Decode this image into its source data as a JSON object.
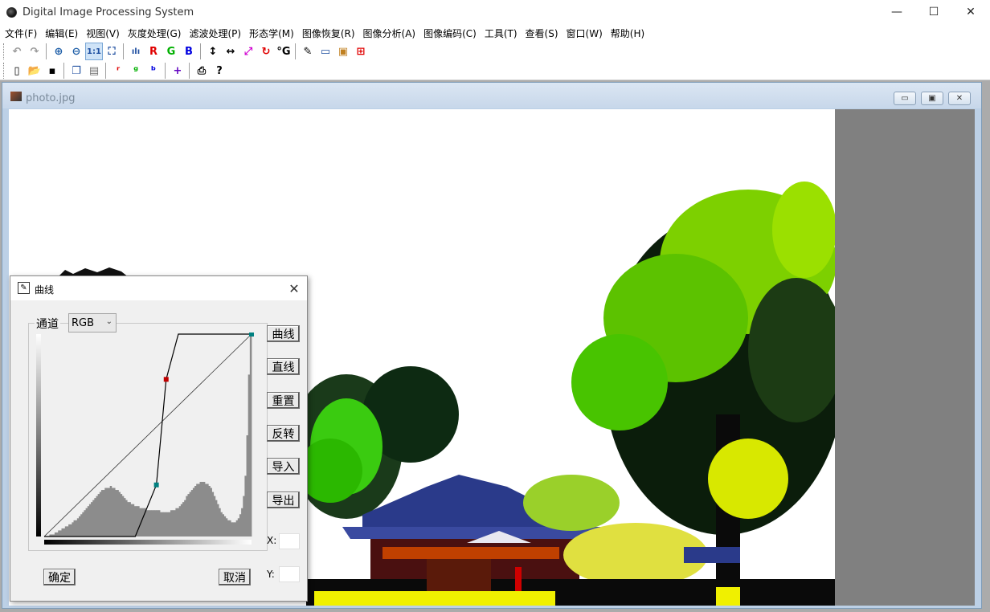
{
  "app": {
    "title": "Digital Image Processing System",
    "minimize": "—",
    "maximize": "☐",
    "close": "✕"
  },
  "menu": [
    "文件(F)",
    "编辑(E)",
    "视图(V)",
    "灰度处理(G)",
    "滤波处理(P)",
    "形态学(M)",
    "图像恢复(R)",
    "图像分析(A)",
    "图像编码(C)",
    "工具(T)",
    "查看(S)",
    "窗口(W)",
    "帮助(H)"
  ],
  "toolbar": {
    "row1": [
      {
        "name": "undo-icon",
        "glyph": "↶",
        "color": "#9a9a9a"
      },
      {
        "name": "redo-icon",
        "glyph": "↷",
        "color": "#9a9a9a"
      },
      {
        "name": "sep"
      },
      {
        "name": "zoom-in-icon",
        "glyph": "⊕",
        "color": "#1f5fa8"
      },
      {
        "name": "zoom-out-icon",
        "glyph": "⊖",
        "color": "#1f5fa8"
      },
      {
        "name": "actual-size-icon",
        "glyph": "1:1",
        "color": "#1f4fa0",
        "active": true
      },
      {
        "name": "fit-window-icon",
        "glyph": "⛶",
        "color": "#1f4fa0"
      },
      {
        "name": "sep"
      },
      {
        "name": "histogram-icon",
        "glyph": "ılı",
        "color": "#1f4fa0"
      },
      {
        "name": "red-channel-icon",
        "glyph": "R",
        "color": "#e00000"
      },
      {
        "name": "green-channel-icon",
        "glyph": "G",
        "color": "#00b000"
      },
      {
        "name": "blue-channel-icon",
        "glyph": "B",
        "color": "#0000e0"
      },
      {
        "name": "sep"
      },
      {
        "name": "flip-vertical-icon",
        "glyph": "↕",
        "color": "#000000"
      },
      {
        "name": "flip-horizontal-icon",
        "glyph": "↔",
        "color": "#000000"
      },
      {
        "name": "resize-icon",
        "glyph": "⤢",
        "color": "#d000d0"
      },
      {
        "name": "rotate-icon",
        "glyph": "↻",
        "color": "#e00000"
      },
      {
        "name": "rotate-angle-icon",
        "glyph": "°G",
        "color": "#000000"
      },
      {
        "name": "sep"
      },
      {
        "name": "curves-icon",
        "glyph": "✎",
        "color": "#000000"
      },
      {
        "name": "levels-icon",
        "glyph": "▭",
        "color": "#1f4fa0"
      },
      {
        "name": "image-adjust-icon",
        "glyph": "▣",
        "color": "#c08020"
      },
      {
        "name": "grid-icon",
        "glyph": "⊞",
        "color": "#e00000"
      }
    ],
    "row2": [
      {
        "name": "new-file-icon",
        "glyph": "▯",
        "color": "#000000"
      },
      {
        "name": "open-folder-icon",
        "glyph": "📂",
        "color": "#c09000"
      },
      {
        "name": "save-icon",
        "glyph": "▪",
        "color": "#000000"
      },
      {
        "name": "sep"
      },
      {
        "name": "copy-icon",
        "glyph": "❐",
        "color": "#1f4fa0"
      },
      {
        "name": "paste-icon",
        "glyph": "▤",
        "color": "#707070"
      },
      {
        "name": "sep"
      },
      {
        "name": "red-component-icon",
        "glyph": "ʳ",
        "color": "#e00000"
      },
      {
        "name": "green-component-icon",
        "glyph": "ᵍ",
        "color": "#00b000"
      },
      {
        "name": "blue-component-icon",
        "glyph": "ᵇ",
        "color": "#0000e0"
      },
      {
        "name": "sep"
      },
      {
        "name": "crosshair-icon",
        "glyph": "+",
        "color": "#6000c0"
      },
      {
        "name": "sep"
      },
      {
        "name": "print-icon",
        "glyph": "⎙",
        "color": "#000000"
      },
      {
        "name": "help-icon",
        "glyph": "?",
        "color": "#000000"
      }
    ]
  },
  "child_window": {
    "title": "photo.jpg",
    "minimize": "▭",
    "restore": "▣",
    "close": "✕"
  },
  "dialog": {
    "title": "曲线",
    "close": "✕",
    "channel_label": "通道",
    "channel_value": "RGB",
    "buttons": {
      "curve": "曲线",
      "line": "直线",
      "reset": "重置",
      "invert": "反转",
      "import": "导入",
      "export": "导出",
      "ok": "确定",
      "cancel": "取消"
    },
    "x_label": "X:",
    "y_label": "Y:",
    "x_value": "",
    "y_value": "",
    "curve_points": [
      {
        "in": 0,
        "out": 0
      },
      {
        "in": 112,
        "out": 0
      },
      {
        "in": 138,
        "out": 65
      },
      {
        "in": 150,
        "out": 198
      },
      {
        "in": 165,
        "out": 255
      },
      {
        "in": 255,
        "out": 255
      }
    ],
    "control_points": [
      {
        "in": 138,
        "out": 65,
        "color": "#008080"
      },
      {
        "in": 150,
        "out": 198,
        "color": "#c00000"
      },
      {
        "in": 255,
        "out": 255,
        "color": "#008080"
      }
    ],
    "histogram": [
      0,
      0,
      0,
      1,
      1,
      1,
      2,
      2,
      3,
      3,
      4,
      4,
      5,
      5,
      6,
      6,
      7,
      8,
      8,
      9,
      10,
      11,
      12,
      13,
      14,
      15,
      16,
      17,
      18,
      19,
      20,
      21,
      22,
      23,
      23,
      24,
      24,
      24,
      25,
      24,
      24,
      23,
      23,
      22,
      21,
      20,
      19,
      18,
      17,
      17,
      16,
      16,
      15,
      15,
      15,
      14,
      14,
      14,
      14,
      13,
      13,
      13,
      13,
      13,
      13,
      13,
      13,
      12,
      12,
      12,
      12,
      12,
      12,
      13,
      13,
      13,
      14,
      14,
      15,
      16,
      17,
      18,
      20,
      21,
      22,
      23,
      24,
      25,
      26,
      26,
      27,
      27,
      27,
      26,
      26,
      25,
      24,
      22,
      20,
      18,
      16,
      14,
      12,
      11,
      10,
      9,
      8,
      8,
      7,
      7,
      7,
      8,
      9,
      11,
      14,
      20,
      30,
      50,
      80,
      100
    ]
  }
}
